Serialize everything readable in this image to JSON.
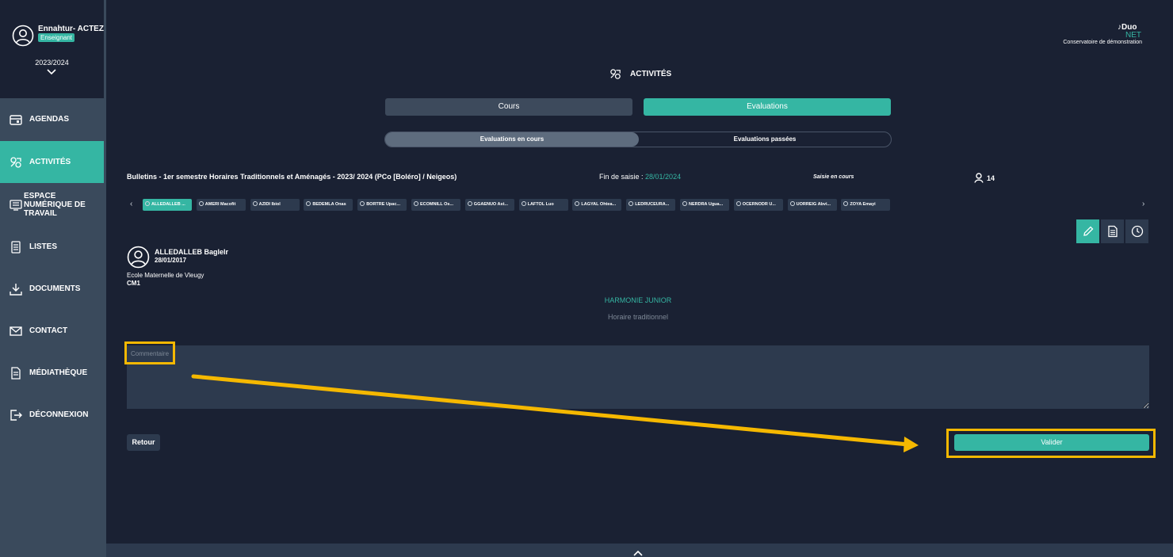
{
  "user": {
    "name": "Ennahtur- ACTEZ",
    "role": "Enseignant",
    "year": "2023/2024"
  },
  "nav": {
    "items": [
      {
        "label": "AGENDAS",
        "icon": "calendar-icon"
      },
      {
        "label": "ACTIVITÉS",
        "icon": "music-activities-icon",
        "active": true
      },
      {
        "label": "ESPACE NUMÉRIQUE DE TRAVAIL",
        "icon": "workspace-icon"
      },
      {
        "label": "LISTES",
        "icon": "list-icon"
      },
      {
        "label": "DOCUMENTS",
        "icon": "download-icon"
      },
      {
        "label": "CONTACT",
        "icon": "mail-icon"
      },
      {
        "label": "MÉDIATHÈQUE",
        "icon": "media-icon"
      },
      {
        "label": "DÉCONNEXION",
        "icon": "logout-icon"
      }
    ]
  },
  "brand": {
    "logo_top": "Duo",
    "logo_bottom": "NET",
    "subtitle": "Conservatoire de démonstration"
  },
  "page": {
    "title": "ACTIVITÉS"
  },
  "tabs": {
    "cours": "Cours",
    "evaluations": "Evaluations"
  },
  "subtabs": {
    "en_cours": "Evaluations en cours",
    "passees": "Evaluations passées"
  },
  "bulletin": {
    "title": "Bulletins - 1er semestre Horaires Traditionnels et Aménagés - 2023/ 2024 (PCo [Boléro] / Neigeos)",
    "fin_label": "Fin de saisie : ",
    "fin_date": "28/01/2024",
    "status": "Saisie en cours",
    "student_count": "14"
  },
  "students": [
    "ALLEDALLEB ...",
    "AMERI Macofit",
    "AZIDI Ibiol",
    "BEDEMLA Onas",
    "BORTRE Upac...",
    "ECOMNILL Os...",
    "GGAENUO Ast...",
    "LAFTOL Luo",
    "LAGYAL Ohtea...",
    "LEDRUCEURA...",
    "NERDRA Ugua...",
    "OCERNODR U...",
    "UORREIG Abvi...",
    "ZOYA Emayi"
  ],
  "student": {
    "name": "ALLEDALLEB Baglelr",
    "dob": "28/01/2017",
    "school": "Ecole Maternelle de Vleugy",
    "class": "CM1"
  },
  "course": {
    "name": "HARMONIE JUNIOR",
    "type": "Horaire traditionnel"
  },
  "form": {
    "comment_placeholder": "Commentaire",
    "retour_label": "Retour",
    "valider_label": "Valider"
  },
  "colors": {
    "accent": "#35b6a3",
    "background": "#1a2133",
    "sidebar": "#3a4a5c",
    "highlight": "#f5b800"
  }
}
